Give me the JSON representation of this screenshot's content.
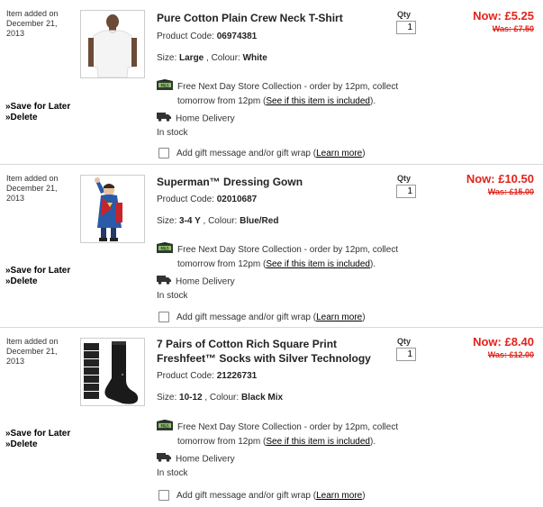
{
  "items": [
    {
      "added_line1": "Item added on",
      "added_line2": "December 21,",
      "added_line3": "2013",
      "save_later": "»Save for Later",
      "delete": "»Delete",
      "title": "Pure Cotton Plain Crew Neck T-Shirt",
      "code_label": "Product Code:",
      "code": "06974381",
      "size_label": "Size:",
      "size": "Large",
      "colour_label": ", Colour:",
      "colour": "White",
      "store_line1": "Free Next Day Store Collection - order by 12pm, collect",
      "store_line2": "tomorrow from 12pm (",
      "store_link": "See if this item is included",
      "store_end": ").",
      "home_delivery": "Home Delivery",
      "stock": "In stock",
      "gift_text": "Add gift message and/or gift wrap (",
      "gift_link": "Learn more",
      "gift_end": ")",
      "qty_label": "Qty",
      "qty": "1",
      "now": "Now: £5.25",
      "was": "Was: £7.50"
    },
    {
      "added_line1": "Item added on",
      "added_line2": "December 21,",
      "added_line3": "2013",
      "save_later": "»Save for Later",
      "delete": "»Delete",
      "title": "Superman™ Dressing Gown",
      "code_label": "Product Code:",
      "code": "02010687",
      "size_label": "Size:",
      "size": "3-4 Y",
      "colour_label": ", Colour:",
      "colour": "Blue/Red",
      "store_line1": "Free Next Day Store Collection - order by 12pm, collect",
      "store_line2": "tomorrow from 12pm (",
      "store_link": "See if this item is included",
      "store_end": ").",
      "home_delivery": "Home Delivery",
      "stock": "In stock",
      "gift_text": "Add gift message and/or gift wrap (",
      "gift_link": "Learn more",
      "gift_end": ")",
      "qty_label": "Qty",
      "qty": "1",
      "now": "Now: £10.50",
      "was": "Was: £15.00"
    },
    {
      "added_line1": "Item added on",
      "added_line2": "December 21,",
      "added_line3": "2013",
      "save_later": "»Save for Later",
      "delete": "»Delete",
      "title": "7 Pairs of Cotton Rich Square Print Freshfeet™ Socks with Silver Technology",
      "code_label": "Product Code:",
      "code": "21226731",
      "size_label": "Size:",
      "size": "10-12",
      "colour_label": ", Colour:",
      "colour": "Black Mix",
      "store_line1": "Free Next Day Store Collection - order by 12pm, collect",
      "store_line2": "tomorrow from 12pm (",
      "store_link": "See if this item is included",
      "store_end": ").",
      "home_delivery": "Home Delivery",
      "stock": "In stock",
      "gift_text": "Add gift message and/or gift wrap (",
      "gift_link": "Learn more",
      "gift_end": ")",
      "qty_label": "Qty",
      "qty": "1",
      "now": "Now: £8.40",
      "was": "Was: £12.00"
    }
  ],
  "icons": {
    "store": "store-collection-icon",
    "delivery": "delivery-truck-icon"
  },
  "colors": {
    "price": "#e2231a",
    "separator": "#d7d7d7"
  }
}
